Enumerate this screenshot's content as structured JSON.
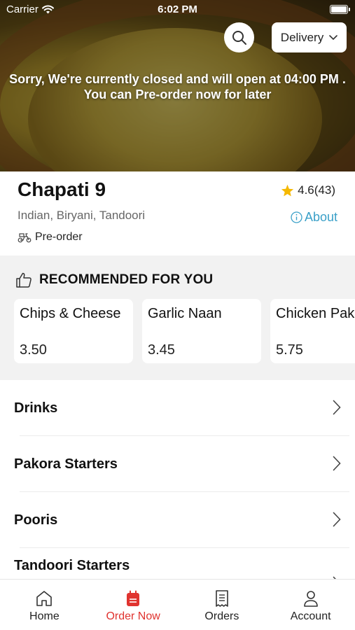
{
  "status_bar": {
    "carrier": "Carrier",
    "time": "6:02 PM"
  },
  "header": {
    "search_icon": "search-icon",
    "delivery_label": "Delivery",
    "closed_message_line1": "Sorry, We're currently closed and will open at 04:00 PM .",
    "closed_message_line2": "You can Pre-order now for later"
  },
  "restaurant": {
    "name": "Chapati 9",
    "rating": "4.6(43)",
    "cuisines": "Indian, Biryani, Tandoori",
    "about_label": "About",
    "preorder_label": "Pre-order"
  },
  "recommended": {
    "title": "RECOMMENDED FOR YOU",
    "items": [
      {
        "name": "Chips & Cheese",
        "price": "3.50"
      },
      {
        "name": "Garlic Naan",
        "price": "3.45"
      },
      {
        "name": "Chicken Pakora",
        "price": "5.75"
      }
    ]
  },
  "categories": [
    "Drinks",
    "Pakora Starters",
    "Pooris",
    "Tandoori Starters"
  ],
  "tabbar": {
    "tabs": [
      {
        "label": "Home",
        "icon": "home-icon"
      },
      {
        "label": "Order Now",
        "icon": "order-bag-icon"
      },
      {
        "label": "Orders",
        "icon": "receipt-icon"
      },
      {
        "label": "Account",
        "icon": "user-icon"
      }
    ],
    "active": "Order Now"
  },
  "colors": {
    "accent": "#e0332f",
    "link": "#3aa0c8",
    "star": "#f5b800"
  }
}
